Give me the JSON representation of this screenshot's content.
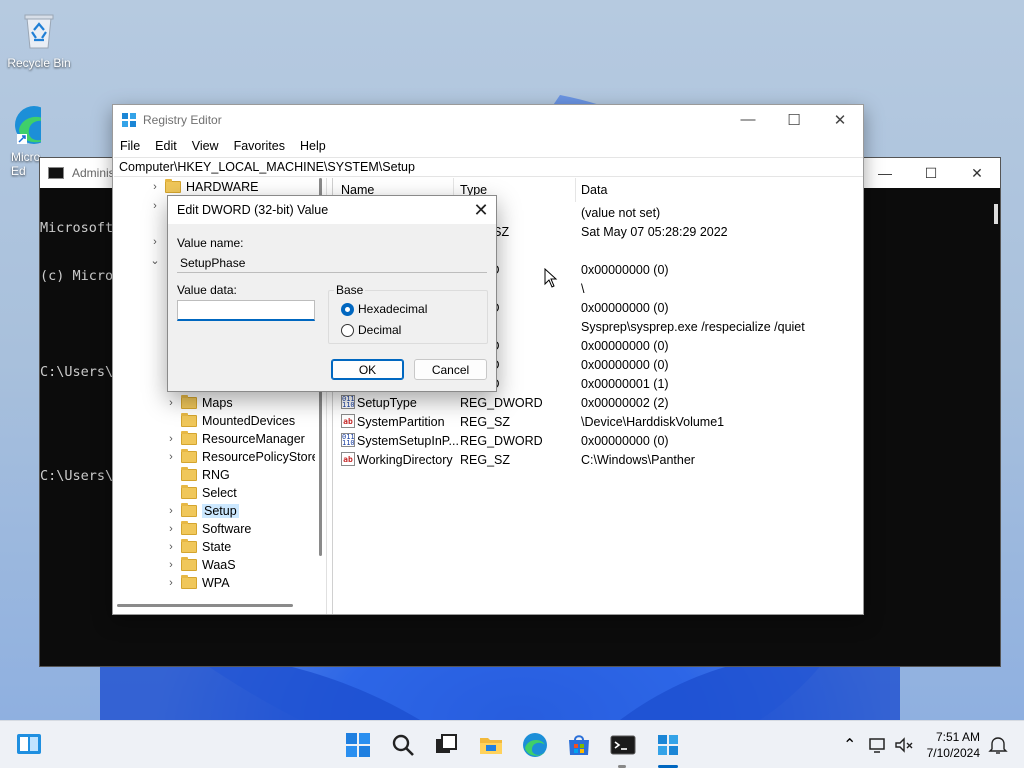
{
  "desktop": {
    "icons": [
      {
        "label": "Recycle Bin"
      },
      {
        "label": "Micro Ed"
      }
    ]
  },
  "cmd": {
    "title": "Adminis",
    "lines": [
      "Microsoft",
      "(c) Micro",
      "",
      "C:\\Users\\",
      "",
      "C:\\Users\\"
    ]
  },
  "regedit": {
    "title": "Registry Editor",
    "menu": [
      "File",
      "Edit",
      "View",
      "Favorites",
      "Help"
    ],
    "address": "Computer\\HKEY_LOCAL_MACHINE\\SYSTEM\\Setup",
    "tree": {
      "top_items": [
        {
          "label": "HARDWARE",
          "chevron": ">"
        }
      ],
      "items": [
        {
          "label": "Maps",
          "chevron": ">"
        },
        {
          "label": "MountedDevices",
          "chevron": ""
        },
        {
          "label": "ResourceManager",
          "chevron": ">"
        },
        {
          "label": "ResourcePolicyStore",
          "chevron": ">"
        },
        {
          "label": "RNG",
          "chevron": ""
        },
        {
          "label": "Select",
          "chevron": ""
        },
        {
          "label": "Setup",
          "chevron": ">",
          "selected": true
        },
        {
          "label": "Software",
          "chevron": ">"
        },
        {
          "label": "State",
          "chevron": ">"
        },
        {
          "label": "WaaS",
          "chevron": ">"
        },
        {
          "label": "WPA",
          "chevron": ">"
        }
      ]
    },
    "columns": {
      "name": "Name",
      "type": "Type",
      "data": "Data"
    },
    "values": [
      {
        "name": "",
        "type": "Z",
        "data": "(value not set)"
      },
      {
        "name": "",
        "type": "ULTI_SZ",
        "data": "Sat May 07 05:28:29 2022"
      },
      {
        "name": "",
        "type": "",
        "data": ""
      },
      {
        "name": "",
        "type": "WORD",
        "data": "0x00000000 (0)"
      },
      {
        "name": "",
        "type": "Z",
        "data": "\\"
      },
      {
        "name": "",
        "type": "WORD",
        "data": "0x00000000 (0)"
      },
      {
        "name": "",
        "type": "Z",
        "data": "Sysprep\\sysprep.exe /respecialize /quiet"
      },
      {
        "name": "",
        "type": "WORD",
        "data": "0x00000000 (0)"
      },
      {
        "name": "",
        "type": "WORD",
        "data": "0x00000000 (0)"
      },
      {
        "name": "",
        "type": "WORD",
        "data": "0x00000001 (1)"
      },
      {
        "name": "SetupType",
        "type": "REG_DWORD",
        "data": "0x00000002 (2)",
        "icon": "dword"
      },
      {
        "name": "SystemPartition",
        "type": "REG_SZ",
        "data": "\\Device\\HarddiskVolume1",
        "icon": "sz"
      },
      {
        "name": "SystemSetupInP...",
        "type": "REG_DWORD",
        "data": "0x00000000 (0)",
        "icon": "dword"
      },
      {
        "name": "WorkingDirectory",
        "type": "REG_SZ",
        "data": "C:\\Windows\\Panther",
        "icon": "sz"
      }
    ]
  },
  "dialog": {
    "title": "Edit DWORD (32-bit) Value",
    "value_name_label": "Value name:",
    "value_name": "SetupPhase",
    "value_data_label": "Value data:",
    "value_data": "",
    "base_label": "Base",
    "radio_hex": "Hexadecimal",
    "radio_dec": "Decimal",
    "ok": "OK",
    "cancel": "Cancel"
  },
  "taskbar": {
    "time": "7:51 AM",
    "date": "7/10/2024"
  },
  "colors": {
    "accent": "#0067c0",
    "selection": "#cce8ff",
    "folder": "#f0c75a"
  }
}
